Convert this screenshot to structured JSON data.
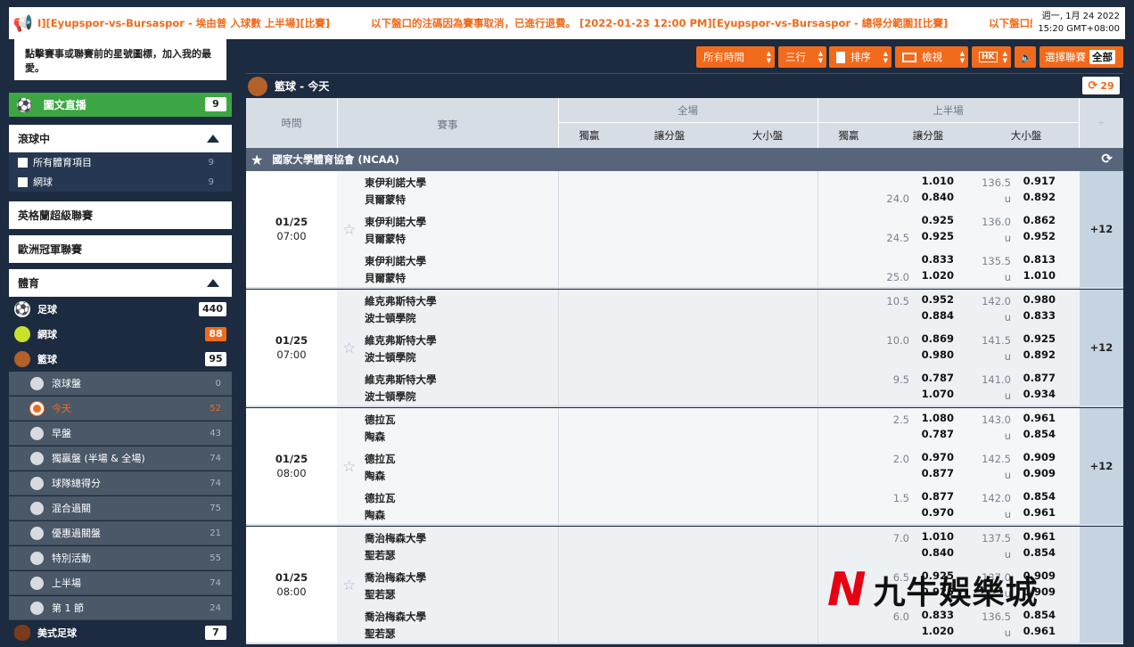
{
  "ticker": {
    "message": "I][Eyupspor-vs-Bursaspor - 埃由普 入球數 上半場][比賽]　　　　以下盤口的注碼因為賽事取消，已進行退費。 [2022-01-23 12:00 PM][Eyupspor-vs-Bursaspor - 總得分範圍][比賽]　　　　以下盤口的注碼",
    "date": "週一, 1月 24 2022",
    "time": "15:20 GMT+08:00"
  },
  "sidebar": {
    "favourite_hint": "點擊賽事或聯賽前的星號圖標，加入我的最愛。",
    "live": {
      "label": "圖文直播",
      "count": "9"
    },
    "inplay": {
      "title": "滾球中",
      "items": [
        {
          "label": "所有體育項目",
          "count": "9"
        },
        {
          "label": "網球",
          "count": "9"
        }
      ]
    },
    "links": [
      "英格蘭超級聯賽",
      "歐洲冠軍聯賽"
    ],
    "sports_title": "體育",
    "sports": [
      {
        "label": "足球",
        "count": "440",
        "color": "#ffffff"
      },
      {
        "label": "網球",
        "count": "88",
        "color": "#c7e22a"
      },
      {
        "label": "籃球",
        "count": "95",
        "color": "#b3602a"
      }
    ],
    "sub_items": [
      {
        "label": "滾球盤",
        "count": "0"
      },
      {
        "label": "今天",
        "count": "52"
      },
      {
        "label": "早盤",
        "count": "43"
      },
      {
        "label": "獨贏盤 (半場 & 全場)",
        "count": "74"
      },
      {
        "label": "球隊總得分",
        "count": "74"
      },
      {
        "label": "混合過關",
        "count": "75"
      },
      {
        "label": "優惠過關盤",
        "count": "21"
      },
      {
        "label": "特別活動",
        "count": "55"
      },
      {
        "label": "上半場",
        "count": "74"
      },
      {
        "label": "第 1 節",
        "count": "24"
      }
    ],
    "american_football": {
      "label": "美式足球",
      "count": "7"
    }
  },
  "toolbar": {
    "all_time": "所有時間",
    "lines": "三行",
    "sort": "排序",
    "view": "檢視",
    "odds": "HK",
    "select_league": "選擇聯賽",
    "all": "全部"
  },
  "section": {
    "title": "籃球 - 今天",
    "refresh": "29"
  },
  "columns": {
    "time": "時間",
    "event": "賽事",
    "full": "全場",
    "half": "上半場",
    "win": "獨贏",
    "handicap": "讓分盤",
    "ou": "大小盤",
    "win_h": "獨贏",
    "handicap_h": "讓分盤",
    "ou_h": "大小盤",
    "plus": "+"
  },
  "league": "國家大學體育協會 (NCAA)",
  "matches": [
    {
      "date": "01/25",
      "time": "07:00",
      "more": "+12",
      "lines": [
        {
          "home": "東伊利諾大學",
          "away": "貝爾蒙特",
          "hdp_h": "",
          "hdp_a": "24.0",
          "hdp_o1": "1.010",
          "hdp_o2": "0.840",
          "ou_l": "136.5",
          "ou_u": "u",
          "ou_o1": "0.917",
          "ou_o2": "0.892"
        },
        {
          "home": "東伊利諾大學",
          "away": "貝爾蒙特",
          "hdp_h": "",
          "hdp_a": "24.5",
          "hdp_o1": "0.925",
          "hdp_o2": "0.925",
          "ou_l": "136.0",
          "ou_u": "u",
          "ou_o1": "0.862",
          "ou_o2": "0.952"
        },
        {
          "home": "東伊利諾大學",
          "away": "貝爾蒙特",
          "hdp_h": "",
          "hdp_a": "25.0",
          "hdp_o1": "0.833",
          "hdp_o2": "1.020",
          "ou_l": "135.5",
          "ou_u": "u",
          "ou_o1": "0.813",
          "ou_o2": "1.010"
        }
      ]
    },
    {
      "date": "01/25",
      "time": "07:00",
      "more": "+12",
      "lines": [
        {
          "home": "維克弗斯特大學",
          "away": "波士頓學院",
          "hdp_h": "10.5",
          "hdp_a": "",
          "hdp_o1": "0.952",
          "hdp_o2": "0.884",
          "ou_l": "142.0",
          "ou_u": "u",
          "ou_o1": "0.980",
          "ou_o2": "0.833"
        },
        {
          "home": "維克弗斯特大學",
          "away": "波士頓學院",
          "hdp_h": "10.0",
          "hdp_a": "",
          "hdp_o1": "0.869",
          "hdp_o2": "0.980",
          "ou_l": "141.5",
          "ou_u": "u",
          "ou_o1": "0.925",
          "ou_o2": "0.892"
        },
        {
          "home": "維克弗斯特大學",
          "away": "波士頓學院",
          "hdp_h": "9.5",
          "hdp_a": "",
          "hdp_o1": "0.787",
          "hdp_o2": "1.070",
          "ou_l": "141.0",
          "ou_u": "u",
          "ou_o1": "0.877",
          "ou_o2": "0.934"
        }
      ]
    },
    {
      "date": "01/25",
      "time": "08:00",
      "more": "+12",
      "lines": [
        {
          "home": "德拉瓦",
          "away": "陶森",
          "hdp_h": "2.5",
          "hdp_a": "",
          "hdp_o1": "1.080",
          "hdp_o2": "0.787",
          "ou_l": "143.0",
          "ou_u": "u",
          "ou_o1": "0.961",
          "ou_o2": "0.854"
        },
        {
          "home": "德拉瓦",
          "away": "陶森",
          "hdp_h": "2.0",
          "hdp_a": "",
          "hdp_o1": "0.970",
          "hdp_o2": "0.877",
          "ou_l": "142.5",
          "ou_u": "u",
          "ou_o1": "0.909",
          "ou_o2": "0.909"
        },
        {
          "home": "德拉瓦",
          "away": "陶森",
          "hdp_h": "1.5",
          "hdp_a": "",
          "hdp_o1": "0.877",
          "hdp_o2": "0.970",
          "ou_l": "142.0",
          "ou_u": "u",
          "ou_o1": "0.854",
          "ou_o2": "0.961"
        }
      ]
    },
    {
      "date": "01/25",
      "time": "08:00",
      "more": "",
      "lines": [
        {
          "home": "喬治梅森大學",
          "away": "聖若瑟",
          "hdp_h": "7.0",
          "hdp_a": "",
          "hdp_o1": "1.010",
          "hdp_o2": "0.840",
          "ou_l": "137.5",
          "ou_u": "u",
          "ou_o1": "0.961",
          "ou_o2": "0.854"
        },
        {
          "home": "喬治梅森大學",
          "away": "聖若瑟",
          "hdp_h": "6.5",
          "hdp_a": "",
          "hdp_o1": "0.925",
          "hdp_o2": "0.925",
          "ou_l": "137.0",
          "ou_u": "u",
          "ou_o1": "0.909",
          "ou_o2": "0.909"
        },
        {
          "home": "喬治梅森大學",
          "away": "聖若瑟",
          "hdp_h": "6.0",
          "hdp_a": "",
          "hdp_o1": "0.833",
          "hdp_o2": "1.020",
          "ou_l": "136.5",
          "ou_u": "u",
          "ou_o1": "0.854",
          "ou_o2": "0.961"
        }
      ]
    }
  ],
  "watermark": {
    "name": "九牛娛樂城"
  }
}
